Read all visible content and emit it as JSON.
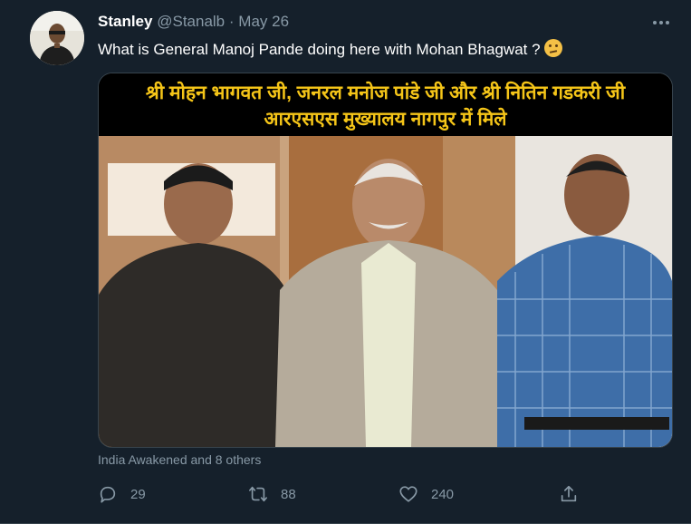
{
  "tweet": {
    "display_name": "Stanley",
    "handle": "@Stanalb",
    "separator": "·",
    "date": "May 26",
    "more_icon": "more-dots-icon",
    "text": "What is General Manoj Pande doing here with Mohan Bhagwat ?",
    "emoji": "thinking-face-emoji"
  },
  "media": {
    "banner_line1": "श्री मोहन भागवत जी, जनरल मनोज पांडे जी और श्री नितिन गडकरी जी",
    "banner_line2": "आरएसएस मुख्यालय नागपुर में मिले",
    "banner_color": "#f5c518"
  },
  "social_context": "India Awakened and 8 others",
  "actions": {
    "reply": {
      "icon": "reply-icon",
      "count": "29"
    },
    "retweet": {
      "icon": "retweet-icon",
      "count": "88"
    },
    "like": {
      "icon": "heart-icon",
      "count": "240"
    },
    "share": {
      "icon": "share-icon"
    }
  },
  "colors": {
    "background": "#15202b",
    "secondary_text": "#8899a6",
    "border": "#38444d"
  }
}
